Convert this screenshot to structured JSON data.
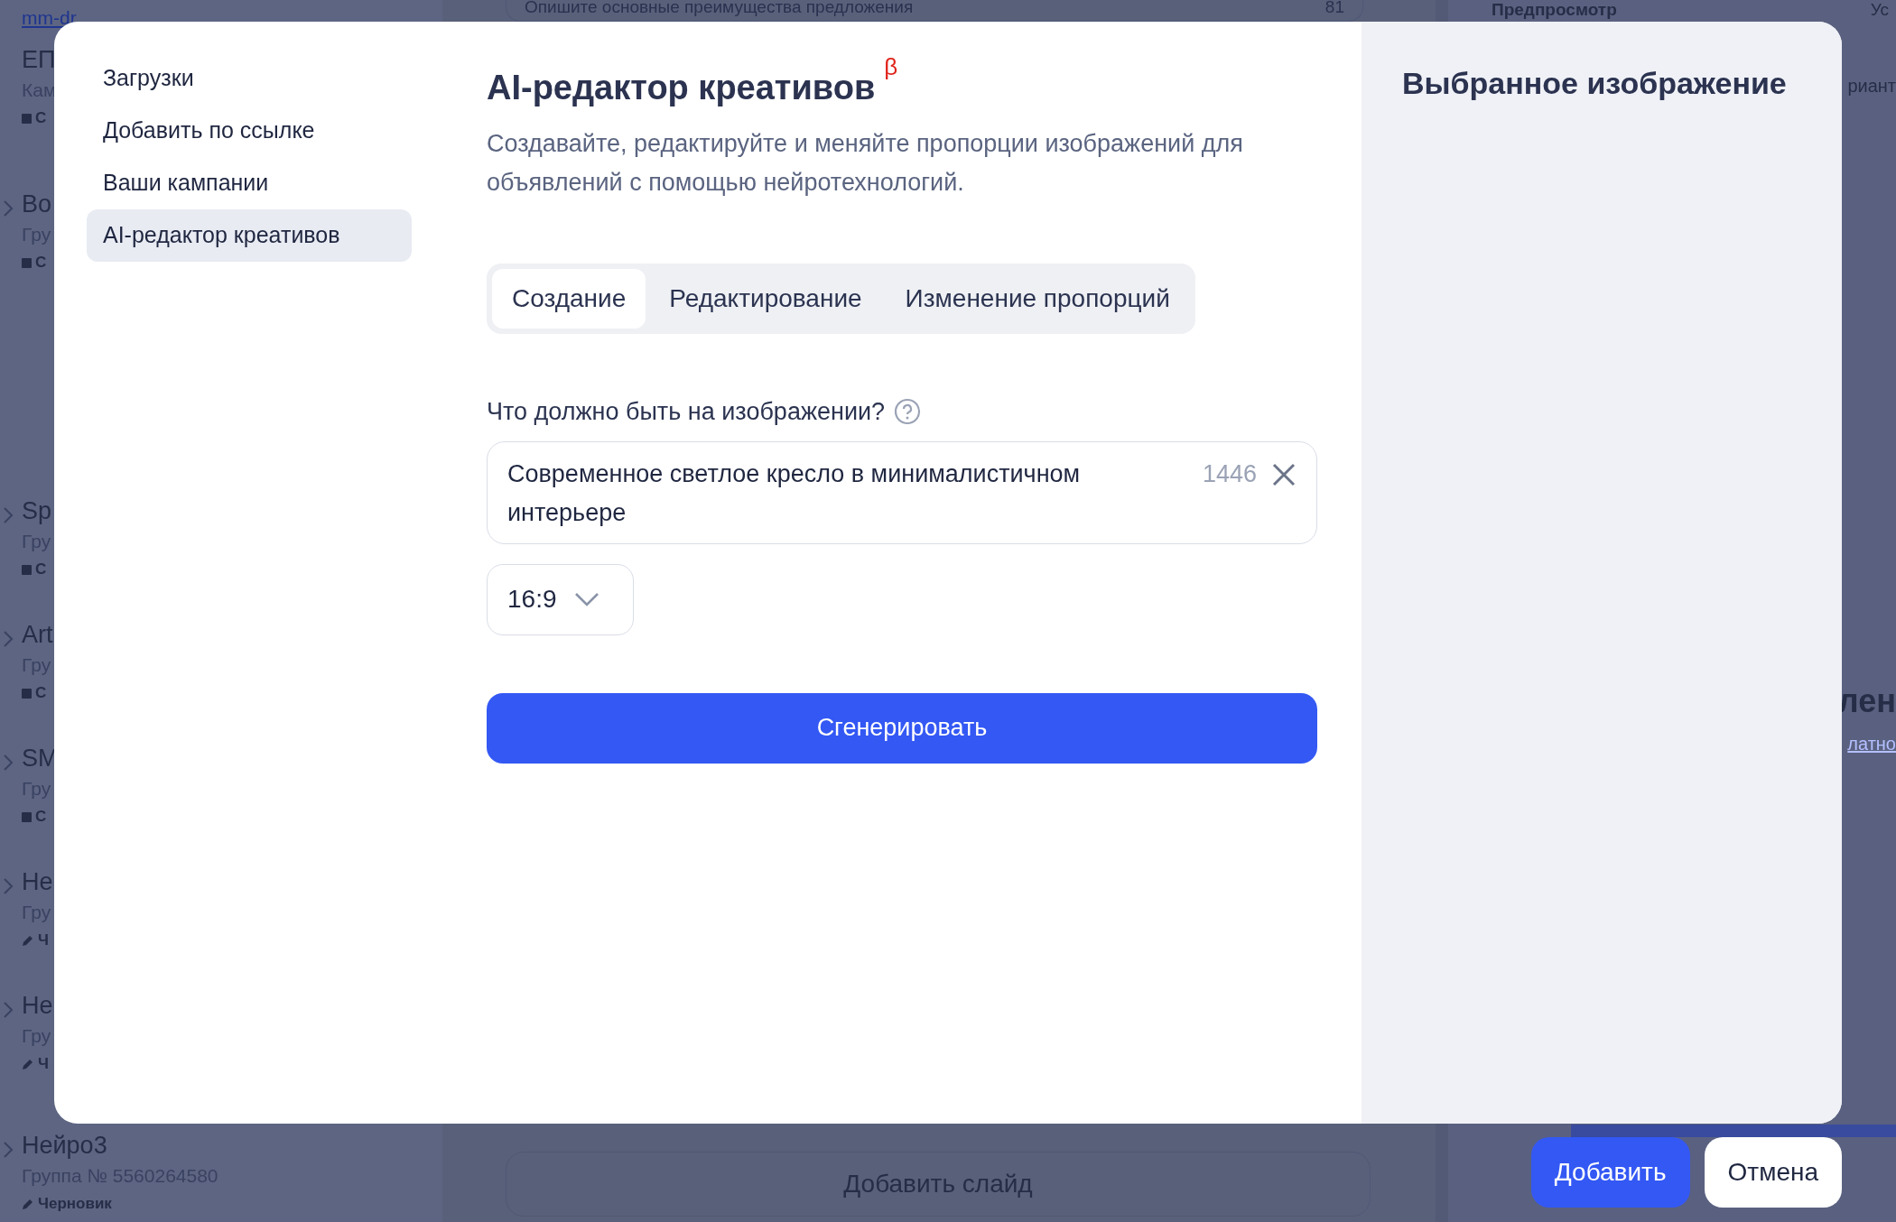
{
  "background": {
    "account_link": "mm-dr",
    "campaigns": [
      {
        "title": "ЕП",
        "subtitle": "Кам",
        "kind": "square",
        "status": "С",
        "chevron": false
      },
      {
        "title": "Во",
        "subtitle": "Гру",
        "kind": "square",
        "status": "С",
        "chevron": true
      },
      {
        "title": "Sp",
        "subtitle": "Гру",
        "kind": "square",
        "status": "С",
        "chevron": true
      },
      {
        "title": "Art",
        "subtitle": "Гру",
        "kind": "square",
        "status": "С",
        "chevron": true
      },
      {
        "title": "SM",
        "subtitle": "Гру",
        "kind": "square",
        "status": "С",
        "chevron": true
      },
      {
        "title": "Не",
        "subtitle": "Гру",
        "kind": "pencil",
        "status": "Ч",
        "chevron": true
      },
      {
        "title": "Не",
        "subtitle": "Гру",
        "kind": "pencil",
        "status": "Ч",
        "chevron": true
      },
      {
        "title": "Нейро3",
        "subtitle": "Группа № 5560264580",
        "kind": "pencil",
        "status": "Черновик",
        "chevron": true
      }
    ],
    "description_field": {
      "placeholder": "Опишите основные преимущества предложения",
      "counter": "81"
    },
    "add_slide_button": "Добавить слайд",
    "preview_heading": "Предпросмотр",
    "right_header_fragment": "Ус",
    "variant_fragment": "риант",
    "section_title_fragment": "лен",
    "section_link_fragment": "латно"
  },
  "nav": [
    {
      "label": "Загрузки",
      "selected": false
    },
    {
      "label": "Добавить по ссылке",
      "selected": false
    },
    {
      "label": "Ваши кампании",
      "selected": false
    },
    {
      "label": "AI-редактор креативов",
      "selected": true
    }
  ],
  "header": {
    "title": "AI-редактор креативов",
    "badge": "β",
    "description": "Создавайте, редактируйте и меняйте пропорции изображений для объявлений с помощью нейротехнологий."
  },
  "tabs": [
    {
      "label": "Создание",
      "selected": true
    },
    {
      "label": "Редактирование",
      "selected": false
    },
    {
      "label": "Изменение пропорций",
      "selected": false
    }
  ],
  "prompt": {
    "label": "Что должно быть на изображении?",
    "value": "Современное светлое кресло в минималистичном интерьере",
    "counter": "1446"
  },
  "ratio": {
    "value": "16:9"
  },
  "generate_button": "Сгенерировать",
  "preview": {
    "title": "Выбранное изображение"
  },
  "footer_buttons": [
    {
      "label": "Добавить",
      "kind": "primary"
    },
    {
      "label": "Отмена",
      "kind": "secondary"
    }
  ]
}
